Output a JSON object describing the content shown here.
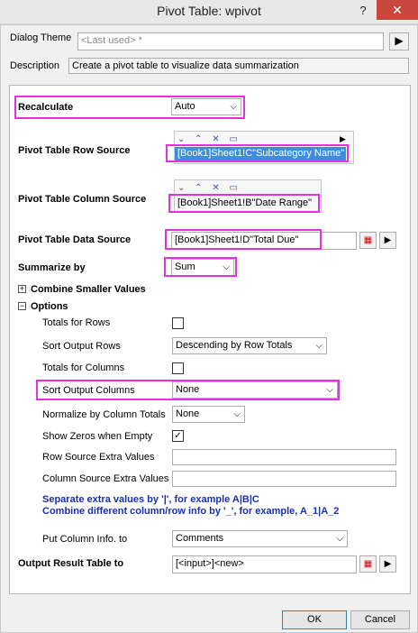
{
  "window": {
    "title": "Pivot Table: wpivot",
    "help": "?",
    "close": "✕"
  },
  "header": {
    "theme_label": "Dialog Theme",
    "theme_value": "<Last used> *",
    "desc_label": "Description",
    "desc_value": "Create a pivot table to visualize data summarization"
  },
  "form": {
    "recalculate_label": "Recalculate",
    "recalculate_value": "Auto",
    "row_source_label": "Pivot Table Row Source",
    "row_source_value": "[Book1]Sheet1!C\"Subcategory Name\"",
    "col_source_label": "Pivot Table Column Source",
    "col_source_value": "[Book1]Sheet1!B\"Date Range\"",
    "data_source_label": "Pivot Table Data Source",
    "data_source_value": "[Book1]Sheet1!D\"Total Due\"",
    "summarize_label": "Summarize by",
    "summarize_value": "Sum",
    "combine_label": "Combine Smaller Values",
    "combine_toggle": "+",
    "options_label": "Options",
    "options_toggle": "−"
  },
  "options": {
    "totals_rows_label": "Totals for Rows",
    "totals_rows_checked": false,
    "sort_rows_label": "Sort Output Rows",
    "sort_rows_value": "Descending by Row Totals",
    "totals_cols_label": "Totals for Columns",
    "totals_cols_checked": false,
    "sort_cols_label": "Sort Output Columns",
    "sort_cols_value": "None",
    "normalize_label": "Normalize by Column Totals",
    "normalize_value": "None",
    "show_zeros_label": "Show Zeros when Empty",
    "show_zeros_mark": "✓",
    "row_extra_label": "Row Source Extra Values",
    "row_extra_value": "",
    "col_extra_label": "Column Source Extra Values",
    "col_extra_value": "",
    "note_line1": "Separate extra values by '|', for example A|B|C",
    "note_line2": "Combine different column/row info by '_', for example, A_1|A_2",
    "put_col_label": "Put Column Info. to",
    "put_col_value": "Comments"
  },
  "output": {
    "label": "Output Result Table to",
    "value": "[<input>]<new>"
  },
  "buttons": {
    "ok": "OK",
    "cancel": "Cancel"
  },
  "icons": {
    "arrow": "▶",
    "dropdown": "⌵",
    "menu_glyphs": "⌄ ⌃ ✕ ▭"
  }
}
